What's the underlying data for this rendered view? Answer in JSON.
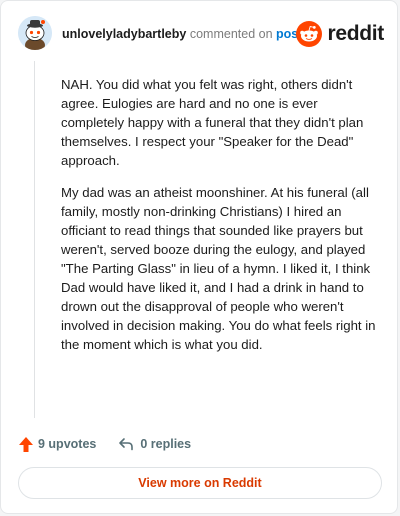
{
  "header": {
    "username": "unlovelyladybartleby",
    "action_text": "commented on",
    "post_link_label": "post",
    "avatar_icon": "snoo-avatar-icon",
    "brand_icon": "reddit-logo-icon",
    "brand_wordmark": "reddit"
  },
  "comment": {
    "paragraphs": [
      "NAH. You did what you felt was right, others didn't agree. Eulogies are hard and no one is ever completely happy with a funeral that they didn't plan themselves. I respect your \"Speaker for the Dead\" approach.",
      "My dad was an atheist moonshiner. At his funeral (all family, mostly non-drinking Christians) I hired an officiant to read things that sounded like prayers but weren't, served booze during the eulogy, and played \"The Parting Glass\" in lieu of a hymn. I liked it, I think Dad would have liked it, and I had a drink in hand to drown out the disapproval of people who weren't involved in decision making. You do what feels right in the moment which is what you did."
    ]
  },
  "actions": {
    "upvotes_label": "9 upvotes",
    "upvote_icon": "upvote-arrow-icon",
    "replies_label": "0 replies",
    "reply_icon": "reply-arrow-icon"
  },
  "footer": {
    "view_more_label": "View more on Reddit"
  },
  "colors": {
    "brand_orange": "#ff4500",
    "link_blue": "#0079d3",
    "view_more_text": "#d93a00",
    "muted_text": "#576f76"
  }
}
